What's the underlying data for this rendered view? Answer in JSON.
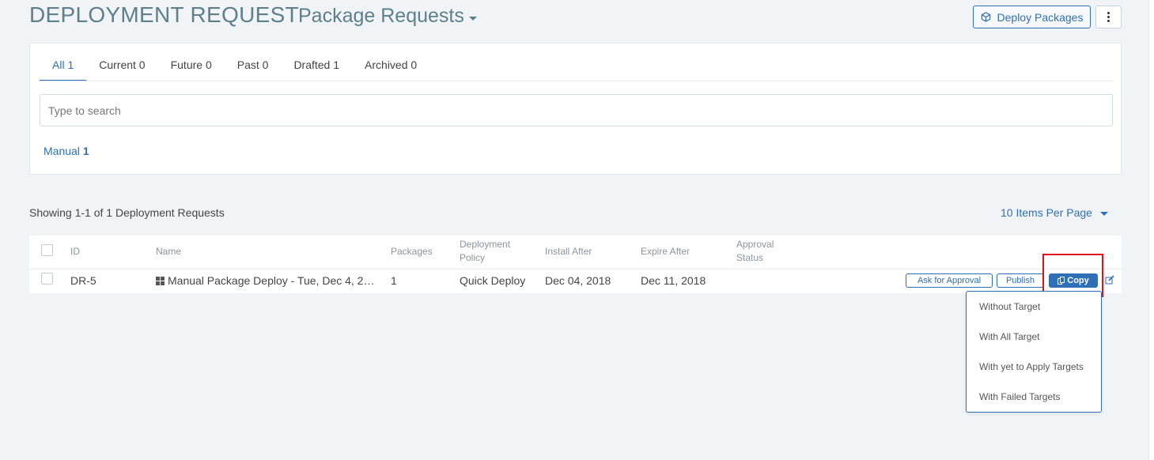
{
  "header": {
    "title": "DEPLOYMENT REQUEST",
    "subtitle": "Package Requests",
    "deploy_button": "Deploy Packages"
  },
  "tabs": [
    {
      "label": "All 1",
      "active": true
    },
    {
      "label": "Current 0",
      "active": false
    },
    {
      "label": "Future 0",
      "active": false
    },
    {
      "label": "Past 0",
      "active": false
    },
    {
      "label": "Drafted 1",
      "active": false
    },
    {
      "label": "Archived 0",
      "active": false
    }
  ],
  "search": {
    "placeholder": "Type to search",
    "value": ""
  },
  "facet": {
    "label": "Manual",
    "count": "1"
  },
  "summary": {
    "showing": "Showing 1-1 of 1 Deployment Requests",
    "per_page": "10 Items Per Page"
  },
  "table": {
    "headers": {
      "id": "ID",
      "name": "Name",
      "packages": "Packages",
      "policy": "Deployment Policy",
      "install_after": "Install After",
      "expire_after": "Expire After",
      "approval_status": "Approval Status"
    },
    "rows": [
      {
        "id": "DR-5",
        "name": "Manual Package Deploy - Tue, Dec 4, 2…",
        "os_icon": "windows-icon",
        "packages": "1",
        "policy": "Quick Deploy",
        "install_after": "Dec 04, 2018",
        "expire_after": "Dec 11, 2018",
        "approval_status": "",
        "actions": {
          "ask_approval": "Ask for Approval",
          "publish": "Publish",
          "copy": "Copy"
        }
      }
    ]
  },
  "copy_menu": [
    "Without Target",
    "With All Target",
    "With yet to Apply Targets",
    "With Failed Targets"
  ],
  "colors": {
    "accent": "#2f6fb7",
    "background": "#f0f4f7",
    "highlight": "#e0131a"
  }
}
